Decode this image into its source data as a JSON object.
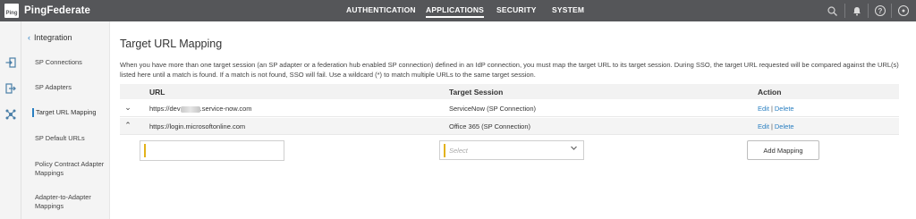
{
  "app": {
    "logo_mark": "Ping",
    "name": "PingFederate"
  },
  "nav": {
    "items": [
      {
        "label": "AUTHENTICATION"
      },
      {
        "label": "APPLICATIONS",
        "active": true
      },
      {
        "label": "SECURITY"
      },
      {
        "label": "SYSTEM"
      }
    ]
  },
  "top_icons": {
    "search": "search-icon",
    "notifications": "bell-icon",
    "help": "help-icon",
    "user": "user-icon",
    "help_glyph": "?",
    "user_glyph": "●"
  },
  "sidebar": {
    "back_chevron": "‹",
    "heading": "Integration",
    "items": [
      {
        "label": "SP Connections"
      },
      {
        "label": "SP Adapters"
      },
      {
        "label": "Target URL Mapping",
        "active": true
      },
      {
        "label": "SP Default URLs"
      },
      {
        "label": "Policy Contract Adapter Mappings"
      },
      {
        "label": "Adapter-to-Adapter Mappings"
      }
    ]
  },
  "page": {
    "title": "Target URL Mapping",
    "description": "When you have more than one target session (an SP adapter or a federation hub enabled SP connection) defined in an IdP connection, you must map the target URL to its target session. During SSO, the target URL requested will be compared against the URL(s) listed here until a match is found. If a match is not found, SSO will fail. Use a wildcard (*) to match multiple URLs to the same target session."
  },
  "table": {
    "headers": {
      "url": "URL",
      "target_session": "Target Session",
      "action": "Action"
    },
    "rows": [
      {
        "chevron": "⌄",
        "url_prefix": "https://dev",
        "url_suffix": ".service-now.com",
        "target_session": "ServiceNow (SP Connection)",
        "edit": "Edit",
        "delete": "Delete"
      },
      {
        "chevron": "⌃",
        "url": "https://login.microsoftonline.com",
        "target_session": "Office 365 (SP Connection)",
        "edit": "Edit",
        "delete": "Delete"
      }
    ],
    "separator": "|",
    "new_row": {
      "url_value": "",
      "select_placeholder": "Select",
      "add_label": "Add Mapping"
    }
  }
}
